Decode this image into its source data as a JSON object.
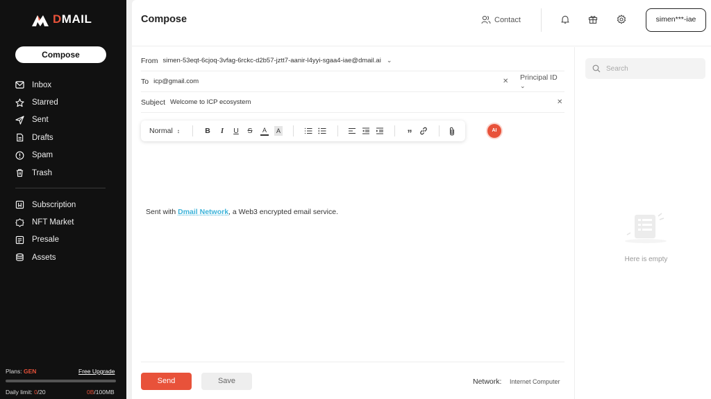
{
  "sidebar": {
    "brand": "DMAIL",
    "compose_label": "Compose",
    "items": [
      {
        "label": "Inbox",
        "icon": "inbox-icon"
      },
      {
        "label": "Starred",
        "icon": "star-icon"
      },
      {
        "label": "Sent",
        "icon": "send-icon"
      },
      {
        "label": "Drafts",
        "icon": "drafts-icon"
      },
      {
        "label": "Spam",
        "icon": "spam-icon"
      },
      {
        "label": "Trash",
        "icon": "trash-icon"
      }
    ],
    "items2": [
      {
        "label": "Subscription",
        "icon": "subscription-icon"
      },
      {
        "label": "NFT Market",
        "icon": "nft-market-icon"
      },
      {
        "label": "Presale",
        "icon": "presale-icon"
      },
      {
        "label": "Assets",
        "icon": "assets-icon"
      }
    ],
    "plans_label": "Plans:",
    "plan_name": "GEN",
    "upgrade_label": "Free Upgrade",
    "daily_limit_label": "Daily limit:",
    "daily_used": "0",
    "daily_total": "/20",
    "storage_used": "0B",
    "storage_total": "/100MB",
    "storage_fraction": 0
  },
  "header": {
    "title": "Compose",
    "contact_label": "Contact",
    "user_label": "simen***-iae"
  },
  "compose": {
    "from_label": "From",
    "from_value": "simen-53eqt-6cjoq-3vfag-6rckc-d2b57-jztt7-aanir-l4yyi-sgaa4-iae@dmail.ai",
    "to_label": "To",
    "to_value": "icp@gmail.com",
    "principal_label": "Principal ID",
    "subject_label": "Subject",
    "subject_value": "Welcome to ICP ecosystem",
    "format_label": "Normal",
    "ai_label": "AI",
    "signature_prefix": "Sent with ",
    "signature_link": "Dmail Network",
    "signature_suffix": ", a Web3 encrypted email service."
  },
  "footer": {
    "send_label": "Send",
    "save_label": "Save",
    "network_label": "Network:",
    "network_value": "Internet Computer"
  },
  "right_panel": {
    "search_placeholder": "Search",
    "empty_label": "Here is empty"
  },
  "colors": {
    "accent": "#e8523a",
    "link": "#3db3d9",
    "sidebar_bg": "#111111"
  }
}
